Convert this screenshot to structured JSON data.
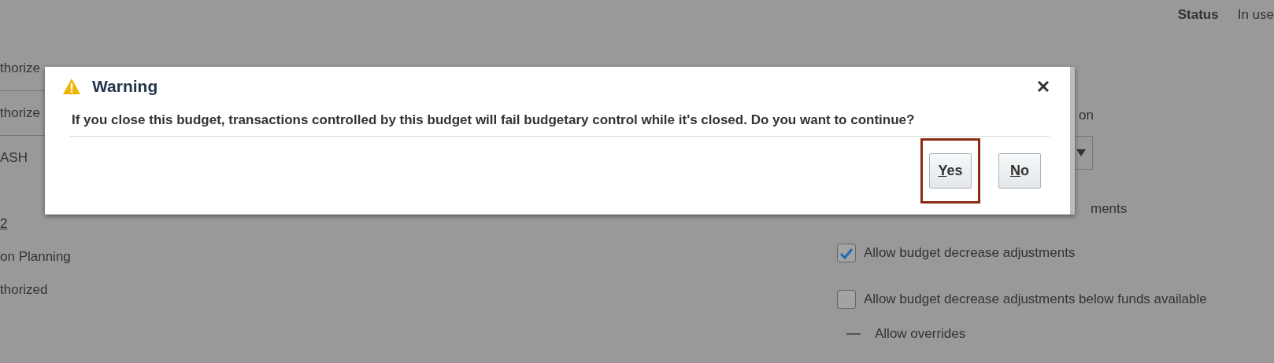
{
  "header": {
    "status_label": "Status",
    "status_value": "In use"
  },
  "left_fields": [
    {
      "kind": "text",
      "text": "thorize",
      "divider": true
    },
    {
      "kind": "text",
      "text": "thorize",
      "divider": true
    },
    {
      "kind": "text",
      "text": "ASH",
      "divider": false
    },
    {
      "kind": "link",
      "text": "2",
      "divider": false
    },
    {
      "kind": "text",
      "text": "on Planning",
      "divider": false
    },
    {
      "kind": "text",
      "text": "thorized",
      "divider": false
    }
  ],
  "right_fields": {
    "label": "on",
    "options": [
      {
        "kind": "covered",
        "label": "ments"
      },
      {
        "kind": "checkbox",
        "label": "Allow budget decrease adjustments",
        "checked": true
      },
      {
        "kind": "checkbox",
        "label": "Allow budget decrease adjustments below funds available",
        "checked": false
      },
      {
        "kind": "indeterminate",
        "label": "Allow overrides"
      }
    ]
  },
  "dialog": {
    "title": "Warning",
    "message": "If you close this budget, transactions controlled by this budget will fail budgetary control while it's closed. Do you want to continue?",
    "buttons": [
      {
        "label": "Yes",
        "highlighted": true
      },
      {
        "label": "No",
        "highlighted": false
      }
    ]
  }
}
